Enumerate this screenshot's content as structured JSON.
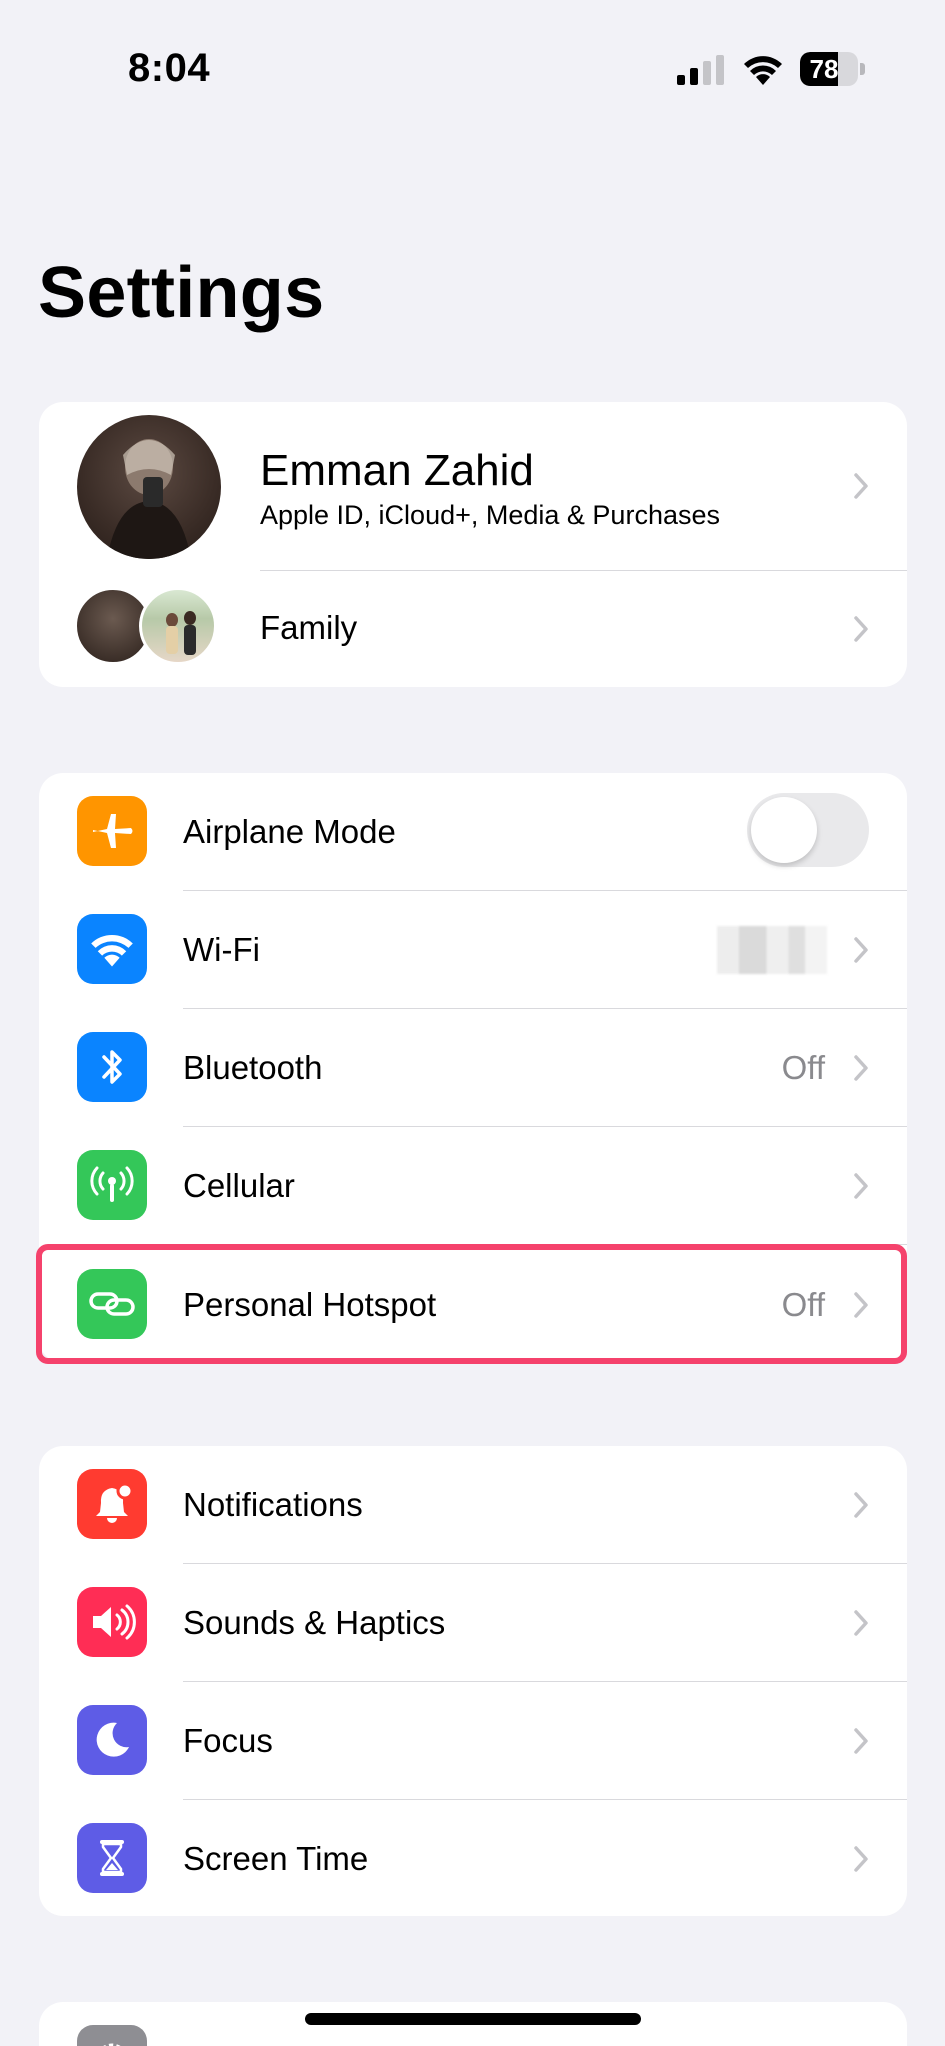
{
  "status_bar": {
    "time": "8:04",
    "battery_level": 78,
    "battery_label": "78"
  },
  "title": "Settings",
  "profile": {
    "name": "Emman Zahid",
    "subtitle": "Apple ID, iCloud+, Media & Purchases",
    "family_label": "Family"
  },
  "connectivity": {
    "airplane_mode": {
      "label": "Airplane Mode",
      "toggle_on": false
    },
    "wifi": {
      "label": "Wi-Fi"
    },
    "bluetooth": {
      "label": "Bluetooth",
      "value": "Off"
    },
    "cellular": {
      "label": "Cellular"
    },
    "hotspot": {
      "label": "Personal Hotspot",
      "value": "Off"
    }
  },
  "general": {
    "notifications": {
      "label": "Notifications"
    },
    "sounds": {
      "label": "Sounds & Haptics"
    },
    "focus": {
      "label": "Focus"
    },
    "screen_time": {
      "label": "Screen Time"
    }
  },
  "colors": {
    "airplane": "#ff9500",
    "wifi": "#0a84ff",
    "bluetooth": "#0a84ff",
    "cellular": "#34c759",
    "hotspot": "#34c759",
    "notifications": "#ff3b30",
    "sounds": "#ff2d55",
    "focus": "#5e5ce6",
    "screen_time": "#5e5ce6",
    "highlight": "#f5426c"
  },
  "icons": {
    "airplane": "airplane-icon",
    "wifi": "wifi-icon",
    "bluetooth": "bluetooth-icon",
    "cellular": "antenna-icon",
    "hotspot": "link-icon",
    "notifications": "bell-icon",
    "sounds": "speaker-icon",
    "focus": "moon-icon",
    "screen_time": "hourglass-icon"
  }
}
